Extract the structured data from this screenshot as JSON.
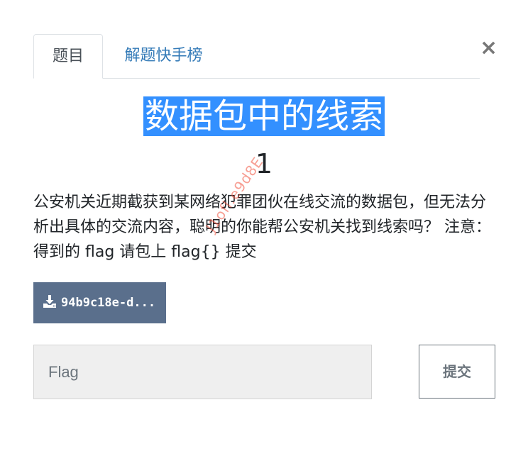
{
  "tabs": [
    {
      "label": "题目",
      "active": true
    },
    {
      "label": "解题快手榜",
      "active": false
    }
  ],
  "close_label": "×",
  "challenge": {
    "title": "数据包中的线索",
    "points": "1",
    "description": "公安机关近期截获到某网络犯罪团伙在线交流的数据包，但无法分析出具体的交流内容，聪明的你能帮公安机关找到线索吗？ 注意：得到的 flag 请包上 flag{} 提交",
    "watermark": "J1ofl.e9d8E"
  },
  "download": {
    "icon": "download-icon",
    "label": "94b9c18e-d..."
  },
  "flag_input": {
    "placeholder": "Flag",
    "value": ""
  },
  "submit_label": "提交",
  "colors": {
    "title_highlight": "#3390ff",
    "link": "#337ab7",
    "download_bg": "#5a6f8c"
  }
}
